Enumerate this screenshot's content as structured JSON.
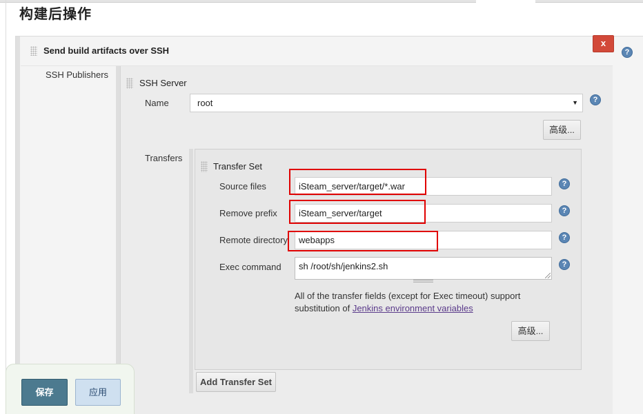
{
  "page": {
    "title": "构建后操作"
  },
  "section": {
    "title": "Send build artifacts over SSH",
    "delete_label": "x"
  },
  "ssh_publishers": {
    "label": "SSH Publishers"
  },
  "ssh_server": {
    "title": "SSH Server",
    "name_label": "Name",
    "name_value": "root",
    "advanced_label": "高级..."
  },
  "transfers": {
    "label": "Transfers",
    "set_title": "Transfer Set",
    "source_files": {
      "label": "Source files",
      "value": "iSteam_server/target/*.war"
    },
    "remove_prefix": {
      "label": "Remove prefix",
      "value": "iSteam_server/target"
    },
    "remote_directory": {
      "label": "Remote directory",
      "value": "webapps"
    },
    "exec_command": {
      "label": "Exec command",
      "value": "sh /root/sh/jenkins2.sh"
    },
    "note_text": "All of the transfer fields (except for Exec timeout) support substitution of ",
    "note_link": "Jenkins environment variables",
    "advanced_label": "高级...",
    "add_set_label": "Add Transfer Set"
  },
  "actions": {
    "save_label": "保存",
    "apply_label": "应用"
  },
  "help_glyph": "?",
  "select_caret": "▼",
  "colors": {
    "delete": "#d24939",
    "highlight": "#e00000",
    "save": "#4c7a8f",
    "apply": "#cfe0f0",
    "help": "#5b86b4"
  }
}
